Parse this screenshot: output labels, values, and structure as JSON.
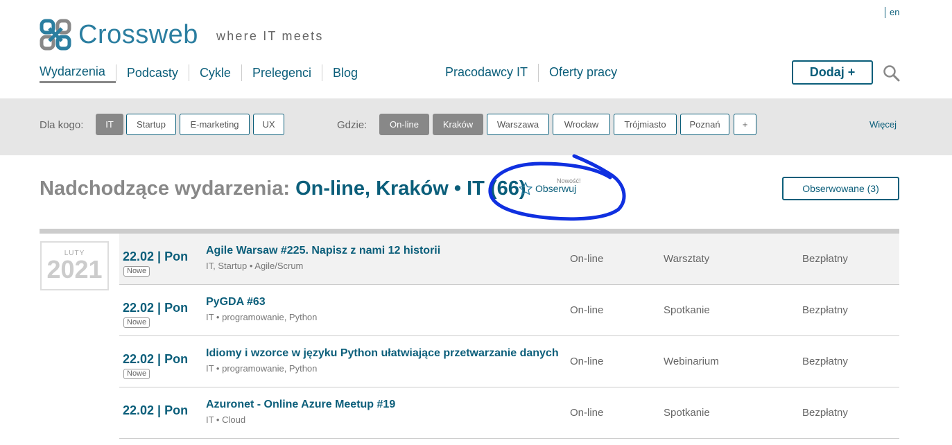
{
  "lang": "en",
  "logo": {
    "name": "Crossweb",
    "tagline": "where IT meets"
  },
  "nav": {
    "left": [
      "Wydarzenia",
      "Podcasty",
      "Cykle",
      "Prelegenci",
      "Blog"
    ],
    "right": [
      "Pracodawcy IT",
      "Oferty pracy"
    ],
    "add_label": "Dodaj +"
  },
  "filters": {
    "audience_label": "Dla kogo:",
    "audience": [
      {
        "label": "IT",
        "selected": true
      },
      {
        "label": "Startup",
        "selected": false
      },
      {
        "label": "E-marketing",
        "selected": false
      },
      {
        "label": "UX",
        "selected": false
      }
    ],
    "where_label": "Gdzie:",
    "where": [
      {
        "label": "On-line",
        "selected": true
      },
      {
        "label": "Kraków",
        "selected": true
      },
      {
        "label": "Warszawa",
        "selected": false
      },
      {
        "label": "Wrocław",
        "selected": false
      },
      {
        "label": "Trójmiasto",
        "selected": false
      },
      {
        "label": "Poznań",
        "selected": false
      },
      {
        "label": "+",
        "selected": false
      }
    ],
    "more_label": "Więcej"
  },
  "heading": {
    "prefix": "Nadchodzące wydarzenia:",
    "filters": "On-line, Kraków • IT (66)"
  },
  "follow": {
    "badge": "Nowość!",
    "label": "Obserwuj"
  },
  "observed_label": "Obserwowane (3)",
  "month": {
    "name": "LUTY",
    "year": "2021"
  },
  "events": [
    {
      "date": "22.02 | Pon",
      "badge": "Nowe",
      "title": "Agile Warsaw #225. Napisz z nami 12 historii",
      "tags": "IT, Startup • Agile/Scrum",
      "location": "On-line",
      "type": "Warsztaty",
      "price": "Bezpłatny"
    },
    {
      "date": "22.02 | Pon",
      "badge": "Nowe",
      "title": "PyGDA #63",
      "tags": "IT • programowanie, Python",
      "location": "On-line",
      "type": "Spotkanie",
      "price": "Bezpłatny"
    },
    {
      "date": "22.02 | Pon",
      "badge": "Nowe",
      "title": "Idiomy i wzorce w języku Python ułatwiające przetwarzanie danych",
      "tags": "IT • programowanie, Python",
      "location": "On-line",
      "type": "Webinarium",
      "price": "Bezpłatny"
    },
    {
      "date": "22.02 | Pon",
      "badge": "",
      "title": "Azuronet - Online Azure Meetup #19",
      "tags": "IT • Cloud",
      "location": "On-line",
      "type": "Spotkanie",
      "price": "Bezpłatny"
    }
  ],
  "colors": {
    "brand": "#0b5e7a",
    "logo": "#2b7ea0",
    "annotation": "#1030e0"
  }
}
